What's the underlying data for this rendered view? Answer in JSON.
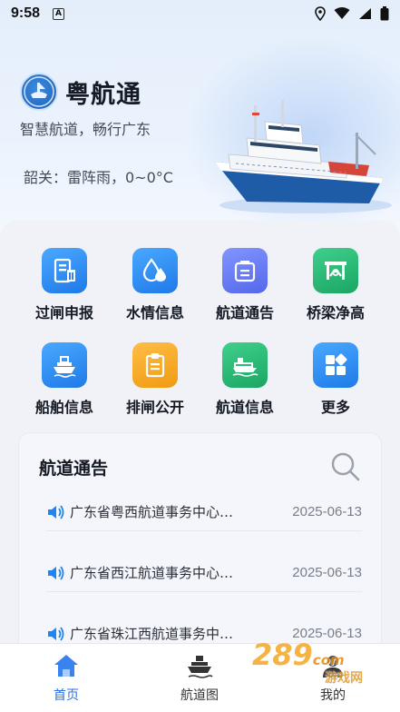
{
  "status_bar": {
    "time": "9:58",
    "badge": "A"
  },
  "header": {
    "app_name": "粤航通",
    "slogan": "智慧航道，畅行广东",
    "weather": "韶关：雷阵雨，0~0°C"
  },
  "menu": [
    {
      "label": "过闸申报",
      "icon": "lock-declare-icon",
      "color": "#2f8ef0"
    },
    {
      "label": "水情信息",
      "icon": "water-drop-icon",
      "color": "#2f8ef0"
    },
    {
      "label": "航道通告",
      "icon": "notice-bag-icon",
      "color": "#5b74f2"
    },
    {
      "label": "桥梁净高",
      "icon": "bridge-icon",
      "color": "#27b776"
    },
    {
      "label": "船舶信息",
      "icon": "ship-icon",
      "color": "#2f8ef0"
    },
    {
      "label": "排闸公开",
      "icon": "clipboard-icon",
      "color": "#f1a623"
    },
    {
      "label": "航道信息",
      "icon": "channel-ship-icon",
      "color": "#27b776"
    },
    {
      "label": "更多",
      "icon": "more-grid-icon",
      "color": "#2f8ef0"
    }
  ],
  "notices": {
    "title": "航道通告",
    "items": [
      {
        "text": "广东省粤西航道事务中心…",
        "date": "2025-06-13"
      },
      {
        "text": "广东省西江航道事务中心…",
        "date": "2025-06-13"
      },
      {
        "text": "广东省珠江西航道事务中…",
        "date": "2025-06-13"
      }
    ]
  },
  "bottom_nav": [
    {
      "label": "首页",
      "active": true
    },
    {
      "label": "航道图",
      "active": false
    },
    {
      "label": "我的",
      "active": false
    }
  ],
  "watermark": {
    "brand": "289",
    "suffix": "com",
    "site": "游戏网"
  }
}
